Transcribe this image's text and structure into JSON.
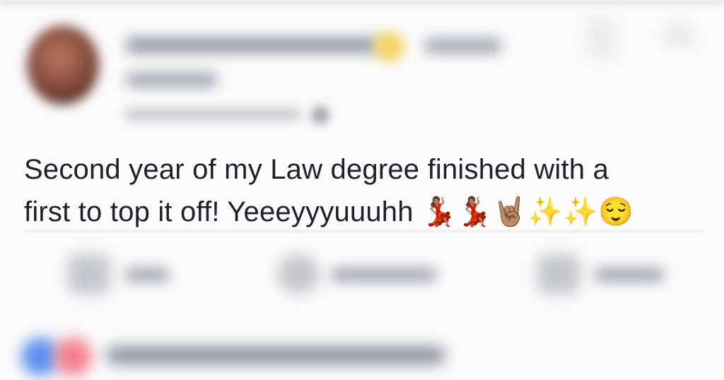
{
  "post": {
    "line1": "Second year of my Law degree finished with a",
    "line2": "first to top it off! Yeeeyyyuuuhh 💃🏽💃🏽🤘🏽✨✨😌"
  },
  "header": {
    "author_icon": "avatar",
    "privacy_icon": "globe-icon"
  },
  "actions": {
    "like_icon": "like-icon",
    "comment_icon": "comment-icon",
    "share_icon": "share-icon"
  },
  "colors": {
    "text": "#1d2129",
    "like_reaction": "#5b8ff0",
    "love_reaction": "#f2808f",
    "background": "#fbfbfb"
  }
}
